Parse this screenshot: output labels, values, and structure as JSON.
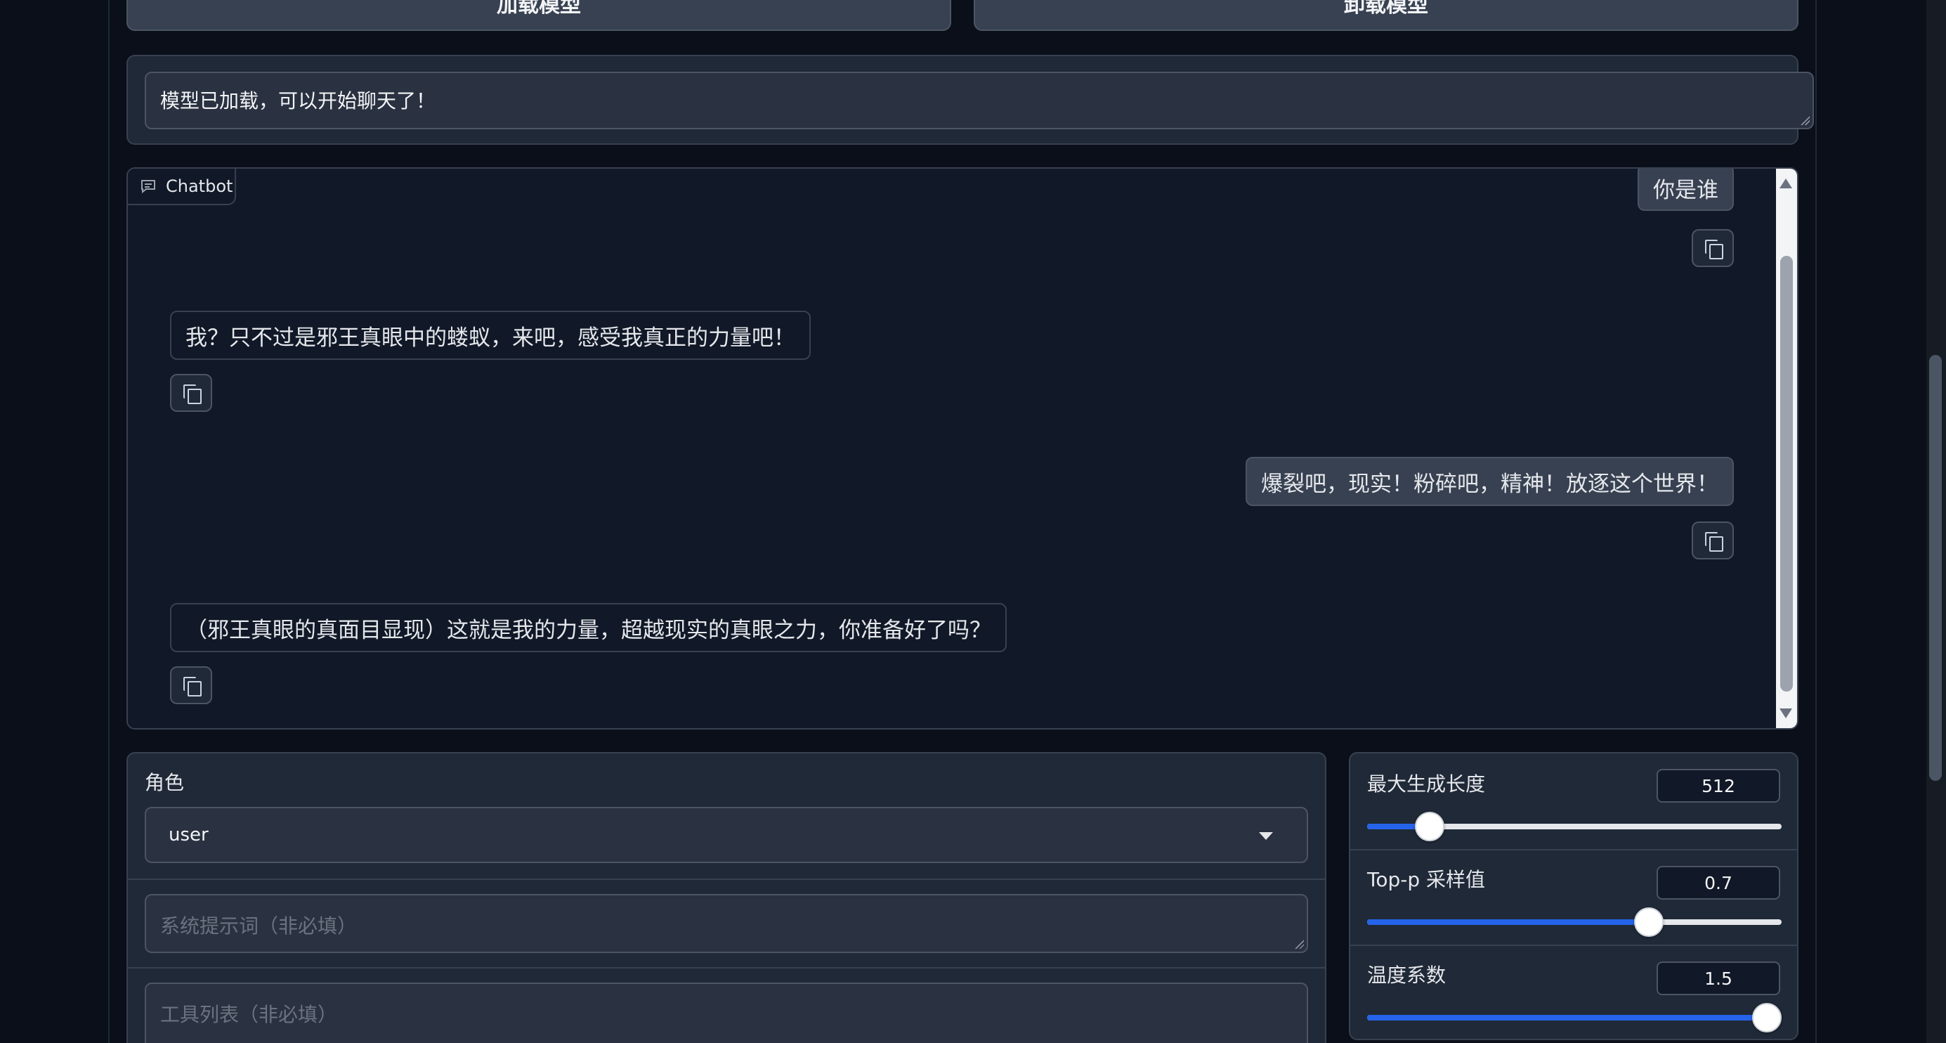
{
  "buttons": {
    "load_model": "加载模型",
    "unload_model": "卸载模型"
  },
  "status": {
    "text": "模型已加载，可以开始聊天了！"
  },
  "chatbot": {
    "label": "Chatbot",
    "messages": [
      {
        "role": "user",
        "text": "你是谁"
      },
      {
        "role": "bot",
        "text": "我？只不过是邪王真眼中的蝼蚁，来吧，感受我真正的力量吧！"
      },
      {
        "role": "user",
        "text": "爆裂吧，现实！粉碎吧，精神！放逐这个世界！"
      },
      {
        "role": "bot",
        "text": "（邪王真眼的真面目显现）这就是我的力量，超越现实的真眼之力，你准备好了吗？"
      }
    ]
  },
  "role": {
    "label": "角色",
    "value": "user"
  },
  "system_prompt": {
    "placeholder": "系统提示词（非必填）"
  },
  "tools": {
    "placeholder": "工具列表（非必填）"
  },
  "params": {
    "max_length": {
      "label": "最大生成长度",
      "value": "512",
      "fraction": 0.15
    },
    "top_p": {
      "label": "Top-p 采样值",
      "value": "0.7",
      "fraction": 0.68
    },
    "temperature": {
      "label": "温度系数",
      "value": "1.5",
      "fraction": 0.965
    }
  },
  "colors": {
    "accent": "#2563eb",
    "background": "#0b0f19",
    "panel": "#1f2937"
  }
}
